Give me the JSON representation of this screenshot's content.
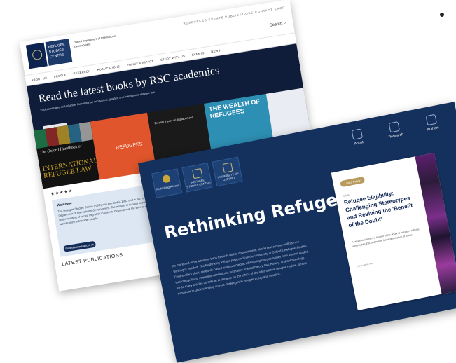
{
  "back_site": {
    "logos": {
      "oxford": "UNIVERSITY OF OXFORD",
      "rsc": "REFUGEE STUDIES CENTRE",
      "tagline": "Oxford Department of International Development"
    },
    "util_links": "RESOURCES  EVENTS  PUBLICATIONS  CONTACT  SHOP",
    "search_label": "Search",
    "nav": [
      "ABOUT US",
      "PEOPLE",
      "RESEARCH",
      "PUBLICATIONS",
      "POLICY & IMPACT",
      "STUDY WITH US",
      "EVENTS",
      "NEWS"
    ],
    "hero": {
      "heading": "Read the latest books by RSC academics",
      "subtext": "Explore refugee self-reliance, humanitarian encounters, gender, and international refugee law",
      "button": "Read more"
    },
    "books": [
      {
        "title": "INTERNATIONAL REFUGEE LAW",
        "kicker": "The Oxford Handbook of"
      },
      {
        "title": "REFUGEES"
      },
      {
        "title": "Ex-ante theory of displacement"
      },
      {
        "title": "THE WEALTH OF REFUGEES"
      }
    ],
    "stars": "★★★★★",
    "welcome": {
      "heading": "Welcome",
      "body": "The Refugee Studies Centre (RSC) was founded in 1982 and is part of the Oxford Department of International Development. The mission is to build knowledge and understanding of forced migration in order to help improve the lives of some of the world's most vulnerable people.",
      "button": "Find out more about us"
    },
    "latest_heading": "LATEST PUBLICATIONS"
  },
  "front_site": {
    "tiles": [
      "Rethinking Refuge",
      "REFUGEE STUDIES CENTRE",
      "UNIVERSITY OF OXFORD"
    ],
    "nav": [
      {
        "label": "About",
        "icon": "info-icon"
      },
      {
        "label": "Research",
        "icon": "globe-icon"
      },
      {
        "label": "Authors",
        "icon": "person-icon"
      }
    ],
    "title": "Rethinking Refuge",
    "intro": "As more and more attention turns towards global displacement, strong research as well as new thinking is needed. The Rethinking Refuge platform from the University of Oxford's Refugee Studies Centre offers short, research-based articles aimed at addressing refugee issues from various angles, including politics, international relations, normative political theory, law, history, and anthropology. While many articles contribute to debates on the ethics of the international refugee regime, others contribute to understanding current challenges in refugee policy and practice.",
    "card": {
      "badge": "Law & Policy",
      "type": "Article",
      "title": "Refugee Eligibility: Challenging Stereotypes and Reviving the 'Benefit of the Doubt'",
      "desc": "A failure to extend the benefit of the doubt to refugees reflects stereotypes that undermine fair determination of status.",
      "meta": "Author name, date"
    }
  }
}
